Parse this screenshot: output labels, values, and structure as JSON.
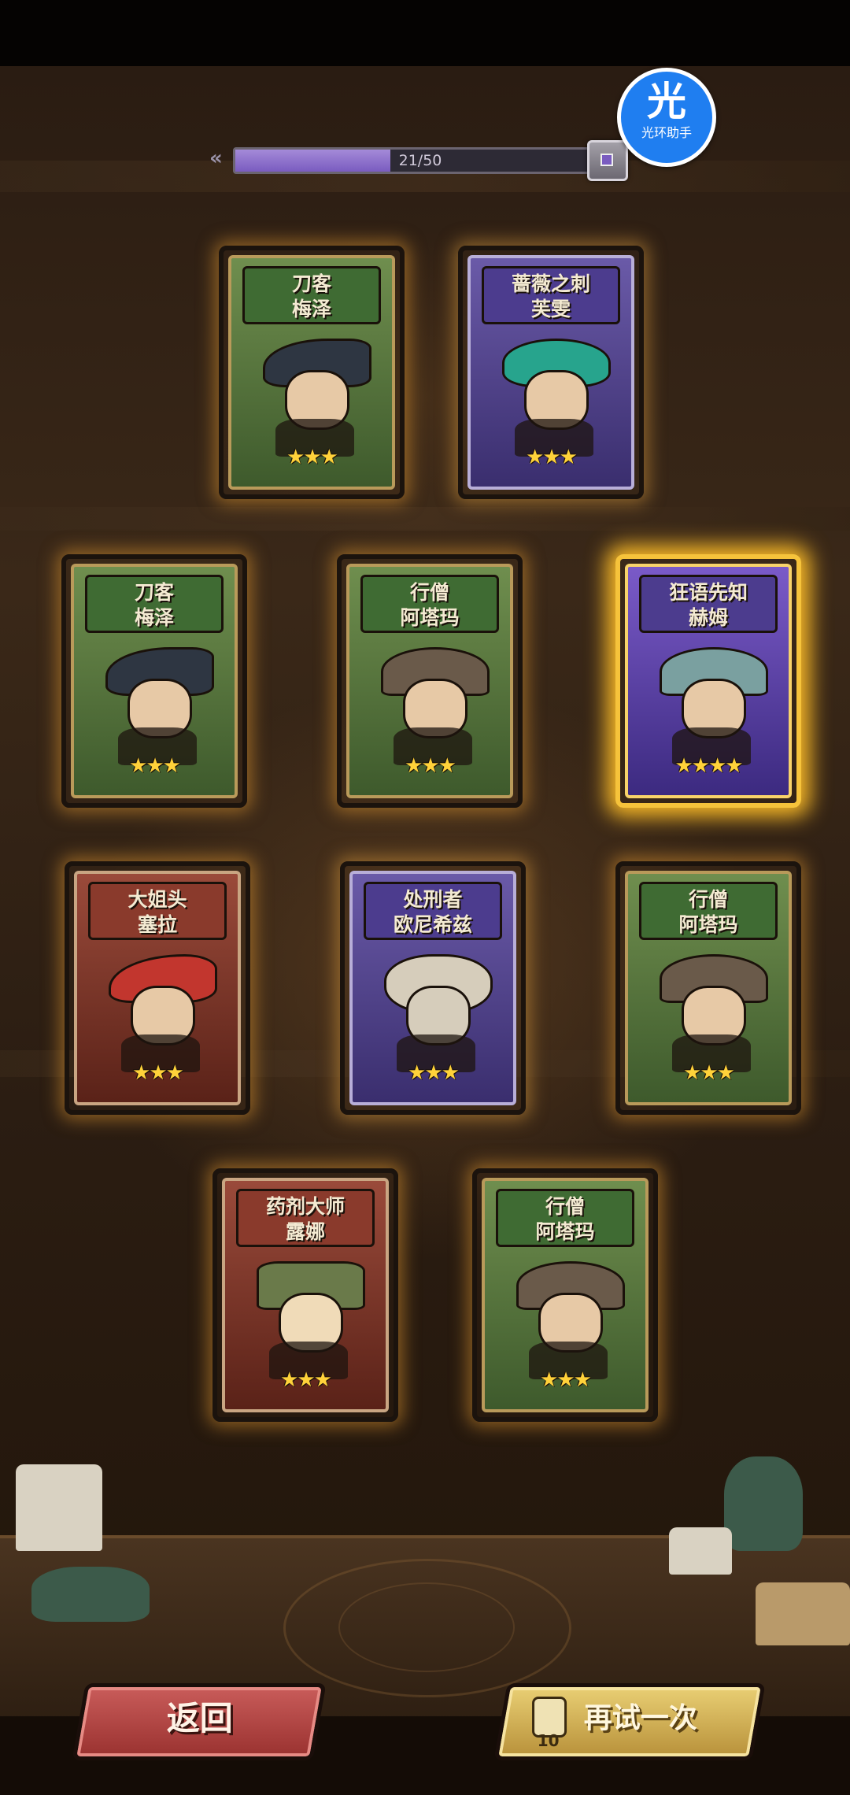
{
  "progress": {
    "value_text": "21/50",
    "fraction": 0.42
  },
  "assistant": {
    "glyph": "光",
    "label": "光环助手"
  },
  "cards": [
    {
      "title_line1": "刀客",
      "title_line2": "梅泽",
      "stars": "★★★",
      "theme": "green"
    },
    {
      "title_line1": "蔷薇之刺",
      "title_line2": "芙雯",
      "stars": "★★★",
      "theme": "purple"
    },
    {
      "title_line1": "刀客",
      "title_line2": "梅泽",
      "stars": "★★★",
      "theme": "green"
    },
    {
      "title_line1": "行僧",
      "title_line2": "阿塔玛",
      "stars": "★★★",
      "theme": "green"
    },
    {
      "title_line1": "狂语先知",
      "title_line2": "赫姆",
      "stars": "★★★★",
      "theme": "legend"
    },
    {
      "title_line1": "大姐头",
      "title_line2": "塞拉",
      "stars": "★★★",
      "theme": "red"
    },
    {
      "title_line1": "处刑者",
      "title_line2": "欧尼希兹",
      "stars": "★★★",
      "theme": "purple"
    },
    {
      "title_line1": "行僧",
      "title_line2": "阿塔玛",
      "stars": "★★★",
      "theme": "green"
    },
    {
      "title_line1": "药剂大师",
      "title_line2": "露娜",
      "stars": "★★★",
      "theme": "red"
    },
    {
      "title_line1": "行僧",
      "title_line2": "阿塔玛",
      "stars": "★★★",
      "theme": "green"
    }
  ],
  "buttons": {
    "back_label": "返回",
    "retry_label": "再试一次",
    "retry_cost": "10"
  },
  "colors": {
    "legend_glow": "#ffbe28",
    "progress_fill": "#7a5cc0",
    "back_button": "#b8433f",
    "retry_button": "#d9b95a"
  }
}
